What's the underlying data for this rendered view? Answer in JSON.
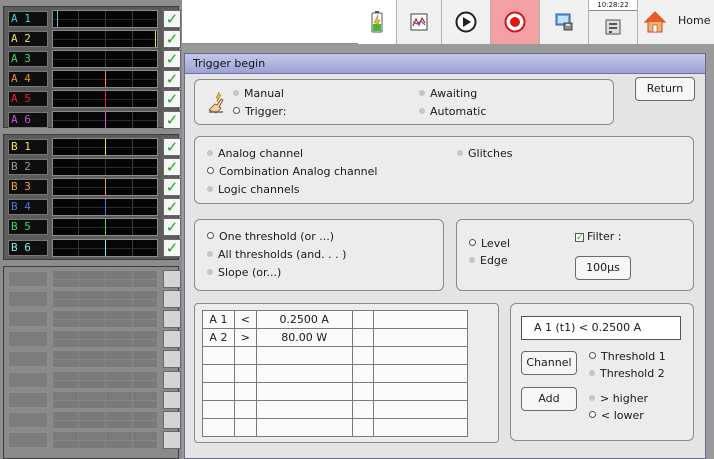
{
  "channels_a": [
    {
      "label": "A 1",
      "color": "#4fc3e8",
      "checked": true,
      "cursor": "#4fc3e8",
      "cursor_pos": 0.04
    },
    {
      "label": "A 2",
      "color": "#e8e24a",
      "checked": true,
      "cursor": "#e8e24a",
      "cursor_pos": 0.98
    },
    {
      "label": "A 3",
      "color": "#3cd65c",
      "checked": true,
      "cursor": "",
      "cursor_pos": 0
    },
    {
      "label": "A 4",
      "color": "#f08c1e",
      "checked": true,
      "cursor": "#f08c1e",
      "cursor_pos": 0.5
    },
    {
      "label": "A 5",
      "color": "#e8242c",
      "checked": true,
      "cursor": "#e8242c",
      "cursor_pos": 0.5
    },
    {
      "label": "A 6",
      "color": "#d04ed8",
      "checked": true,
      "cursor": "#d04ed8",
      "cursor_pos": 0.5
    }
  ],
  "channels_b": [
    {
      "label": "B 1",
      "color": "#f2e84a",
      "checked": true,
      "cursor": "#f2e84a",
      "cursor_pos": 0.5
    },
    {
      "label": "B 2",
      "color": "#9a9a9a",
      "checked": true,
      "cursor": "",
      "cursor_pos": 0
    },
    {
      "label": "B 3",
      "color": "#f0a23c",
      "checked": true,
      "cursor": "#f0a23c",
      "cursor_pos": 0.5
    },
    {
      "label": "B 4",
      "color": "#5a6ee0",
      "checked": true,
      "cursor": "#5a6ee0",
      "cursor_pos": 0.5
    },
    {
      "label": "B 5",
      "color": "#3cd65c",
      "checked": true,
      "cursor": "#3cd65c",
      "cursor_pos": 0.5
    },
    {
      "label": "B 6",
      "color": "#7ee8f2",
      "checked": true,
      "cursor": "#7ee8f2",
      "cursor_pos": 0.5
    }
  ],
  "channels_c_count": 9,
  "toolbar": {
    "clock": "10:28:22",
    "home_label": "Home",
    "icons": [
      "battery-charging-icon",
      "graph-window-icon",
      "play-icon",
      "record-icon",
      "save-computer-icon",
      "settings-clock-icon",
      "home-icon"
    ]
  },
  "trigger": {
    "title": "Trigger begin",
    "return_label": "Return",
    "mode": {
      "manual": "Manual",
      "trigger": "Trigger:",
      "awaiting": "Awaiting",
      "automatic": "Automatic"
    },
    "source": {
      "analog": "Analog channel",
      "combination": "Combination Analog channel",
      "logic": "Logic channels",
      "glitches": "Glitches"
    },
    "threshold_type": {
      "one": "One threshold (or ...)",
      "all": "All thresholds  (and. . . )",
      "slope": "Slope (or...)"
    },
    "detection": {
      "level": "Level",
      "edge": "Edge",
      "filter_label": "Filter :",
      "filter_value": "100µs"
    },
    "conditions": [
      {
        "channel": "A 1",
        "op": "<",
        "value": "0.2500 A"
      },
      {
        "channel": "A 2",
        "op": ">",
        "value": "80.00 W"
      }
    ],
    "editor": {
      "expression": "A 1 (t1) <  0.2500 A",
      "channel_btn": "Channel",
      "add_btn": "Add",
      "threshold1": "Threshold 1",
      "threshold2": "Threshold 2",
      "higher": "> higher",
      "lower": "< lower"
    }
  },
  "colors": {
    "accent_title": "#a8acdc",
    "record_bg": "#f2a0a2",
    "check_green": "#16a816"
  }
}
